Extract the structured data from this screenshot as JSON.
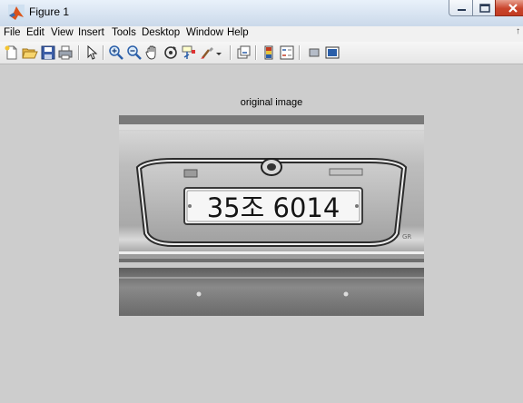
{
  "window": {
    "title": "Figure 1",
    "icon": "matlab-logo-icon",
    "controls": [
      "minimize-icon",
      "maximize-icon",
      "close-icon"
    ]
  },
  "menubar": {
    "items": [
      "File",
      "Edit",
      "View",
      "Insert",
      "Tools",
      "Desktop",
      "Window",
      "Help"
    ]
  },
  "toolbar": {
    "buttons": [
      "new-figure-icon",
      "open-file-icon",
      "save-figure-icon",
      "print-figure-icon",
      "edit-plot-icon",
      "zoom-in-icon",
      "zoom-out-icon",
      "pan-icon",
      "rotate-3d-icon",
      "data-cursor-icon",
      "brush-icon",
      "link-plot-icon",
      "insert-colorbar-icon",
      "insert-legend-icon",
      "hide-plot-tools-icon",
      "show-plot-tools-icon"
    ]
  },
  "figure": {
    "axes_title": "original image",
    "image": {
      "description_kind": "grayscale photo",
      "plate_text": "35조 6014"
    }
  },
  "colors": {
    "figure_background": "#cdcdcd",
    "titlebar": "#dbe6f3",
    "close_button": "#c9452c"
  }
}
